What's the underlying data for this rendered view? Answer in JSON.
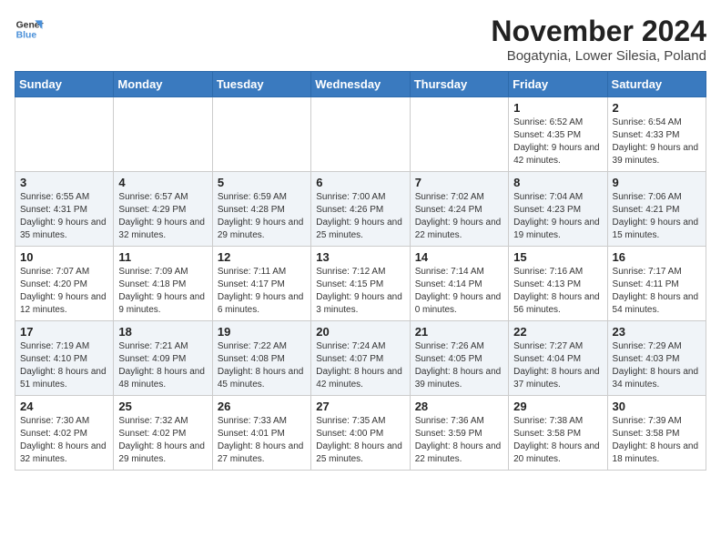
{
  "logo": {
    "line1": "General",
    "line2": "Blue"
  },
  "title": "November 2024",
  "subtitle": "Bogatynia, Lower Silesia, Poland",
  "days_of_week": [
    "Sunday",
    "Monday",
    "Tuesday",
    "Wednesday",
    "Thursday",
    "Friday",
    "Saturday"
  ],
  "weeks": [
    [
      {
        "day": "",
        "info": ""
      },
      {
        "day": "",
        "info": ""
      },
      {
        "day": "",
        "info": ""
      },
      {
        "day": "",
        "info": ""
      },
      {
        "day": "",
        "info": ""
      },
      {
        "day": "1",
        "info": "Sunrise: 6:52 AM\nSunset: 4:35 PM\nDaylight: 9 hours and 42 minutes."
      },
      {
        "day": "2",
        "info": "Sunrise: 6:54 AM\nSunset: 4:33 PM\nDaylight: 9 hours and 39 minutes."
      }
    ],
    [
      {
        "day": "3",
        "info": "Sunrise: 6:55 AM\nSunset: 4:31 PM\nDaylight: 9 hours and 35 minutes."
      },
      {
        "day": "4",
        "info": "Sunrise: 6:57 AM\nSunset: 4:29 PM\nDaylight: 9 hours and 32 minutes."
      },
      {
        "day": "5",
        "info": "Sunrise: 6:59 AM\nSunset: 4:28 PM\nDaylight: 9 hours and 29 minutes."
      },
      {
        "day": "6",
        "info": "Sunrise: 7:00 AM\nSunset: 4:26 PM\nDaylight: 9 hours and 25 minutes."
      },
      {
        "day": "7",
        "info": "Sunrise: 7:02 AM\nSunset: 4:24 PM\nDaylight: 9 hours and 22 minutes."
      },
      {
        "day": "8",
        "info": "Sunrise: 7:04 AM\nSunset: 4:23 PM\nDaylight: 9 hours and 19 minutes."
      },
      {
        "day": "9",
        "info": "Sunrise: 7:06 AM\nSunset: 4:21 PM\nDaylight: 9 hours and 15 minutes."
      }
    ],
    [
      {
        "day": "10",
        "info": "Sunrise: 7:07 AM\nSunset: 4:20 PM\nDaylight: 9 hours and 12 minutes."
      },
      {
        "day": "11",
        "info": "Sunrise: 7:09 AM\nSunset: 4:18 PM\nDaylight: 9 hours and 9 minutes."
      },
      {
        "day": "12",
        "info": "Sunrise: 7:11 AM\nSunset: 4:17 PM\nDaylight: 9 hours and 6 minutes."
      },
      {
        "day": "13",
        "info": "Sunrise: 7:12 AM\nSunset: 4:15 PM\nDaylight: 9 hours and 3 minutes."
      },
      {
        "day": "14",
        "info": "Sunrise: 7:14 AM\nSunset: 4:14 PM\nDaylight: 9 hours and 0 minutes."
      },
      {
        "day": "15",
        "info": "Sunrise: 7:16 AM\nSunset: 4:13 PM\nDaylight: 8 hours and 56 minutes."
      },
      {
        "day": "16",
        "info": "Sunrise: 7:17 AM\nSunset: 4:11 PM\nDaylight: 8 hours and 54 minutes."
      }
    ],
    [
      {
        "day": "17",
        "info": "Sunrise: 7:19 AM\nSunset: 4:10 PM\nDaylight: 8 hours and 51 minutes."
      },
      {
        "day": "18",
        "info": "Sunrise: 7:21 AM\nSunset: 4:09 PM\nDaylight: 8 hours and 48 minutes."
      },
      {
        "day": "19",
        "info": "Sunrise: 7:22 AM\nSunset: 4:08 PM\nDaylight: 8 hours and 45 minutes."
      },
      {
        "day": "20",
        "info": "Sunrise: 7:24 AM\nSunset: 4:07 PM\nDaylight: 8 hours and 42 minutes."
      },
      {
        "day": "21",
        "info": "Sunrise: 7:26 AM\nSunset: 4:05 PM\nDaylight: 8 hours and 39 minutes."
      },
      {
        "day": "22",
        "info": "Sunrise: 7:27 AM\nSunset: 4:04 PM\nDaylight: 8 hours and 37 minutes."
      },
      {
        "day": "23",
        "info": "Sunrise: 7:29 AM\nSunset: 4:03 PM\nDaylight: 8 hours and 34 minutes."
      }
    ],
    [
      {
        "day": "24",
        "info": "Sunrise: 7:30 AM\nSunset: 4:02 PM\nDaylight: 8 hours and 32 minutes."
      },
      {
        "day": "25",
        "info": "Sunrise: 7:32 AM\nSunset: 4:02 PM\nDaylight: 8 hours and 29 minutes."
      },
      {
        "day": "26",
        "info": "Sunrise: 7:33 AM\nSunset: 4:01 PM\nDaylight: 8 hours and 27 minutes."
      },
      {
        "day": "27",
        "info": "Sunrise: 7:35 AM\nSunset: 4:00 PM\nDaylight: 8 hours and 25 minutes."
      },
      {
        "day": "28",
        "info": "Sunrise: 7:36 AM\nSunset: 3:59 PM\nDaylight: 8 hours and 22 minutes."
      },
      {
        "day": "29",
        "info": "Sunrise: 7:38 AM\nSunset: 3:58 PM\nDaylight: 8 hours and 20 minutes."
      },
      {
        "day": "30",
        "info": "Sunrise: 7:39 AM\nSunset: 3:58 PM\nDaylight: 8 hours and 18 minutes."
      }
    ]
  ]
}
